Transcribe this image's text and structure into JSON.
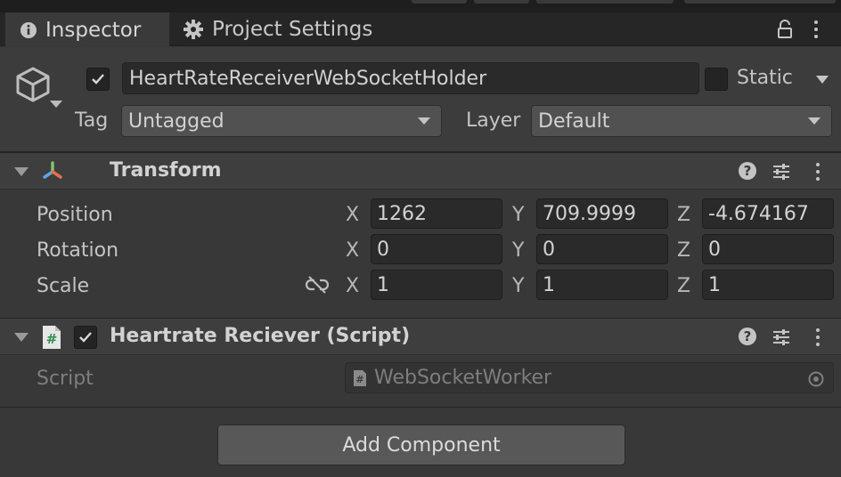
{
  "tabs": [
    {
      "label": "Inspector",
      "icon": "info-icon"
    },
    {
      "label": "Project Settings",
      "icon": "gear-icon"
    }
  ],
  "header": {
    "active": true,
    "name": "HeartRateReceiverWebSocketHolder",
    "static_label": "Static",
    "static_checked": false,
    "tag_label": "Tag",
    "tag_value": "Untagged",
    "layer_label": "Layer",
    "layer_value": "Default"
  },
  "transform": {
    "title": "Transform",
    "position": {
      "label": "Position",
      "x": "1262",
      "y": "709.9999",
      "z": "-4.674167"
    },
    "rotation": {
      "label": "Rotation",
      "x": "0",
      "y": "0",
      "z": "0"
    },
    "scale": {
      "label": "Scale",
      "x": "1",
      "y": "1",
      "z": "1"
    },
    "axis_labels": {
      "x": "X",
      "y": "Y",
      "z": "Z"
    }
  },
  "script_component": {
    "title": "Heartrate Reciever (Script)",
    "enabled": true,
    "script_label": "Script",
    "script_value": "WebSocketWorker"
  },
  "add_component_label": "Add Component",
  "colors": {
    "background": "#383838",
    "tabbar": "#262626",
    "field": "#2a2a2a",
    "dropdown": "#515151",
    "button": "#585858"
  }
}
